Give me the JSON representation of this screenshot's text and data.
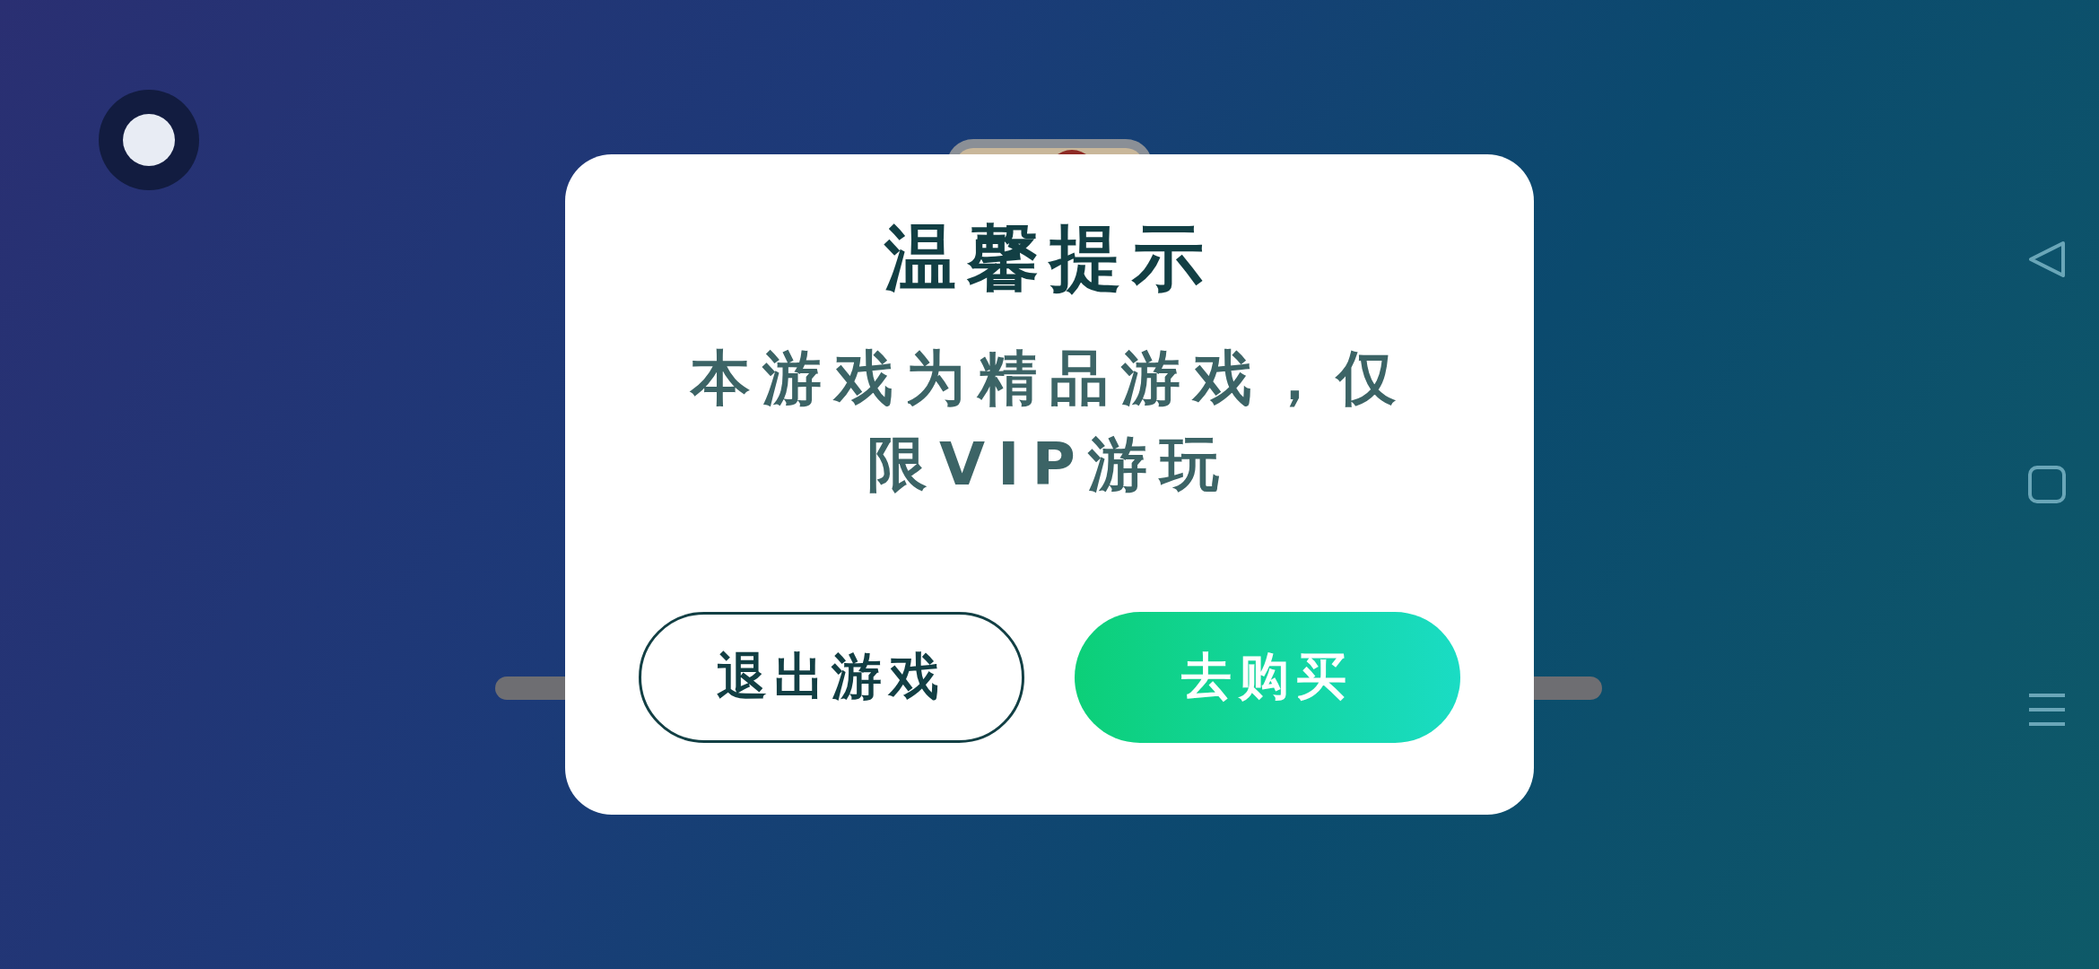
{
  "dialog": {
    "title": "温馨提示",
    "message": "本游戏为精品游戏，仅限VIP游玩",
    "buttons": [
      {
        "label": "退出游戏",
        "kind": "outline"
      },
      {
        "label": "去购买",
        "kind": "primary"
      }
    ]
  }
}
